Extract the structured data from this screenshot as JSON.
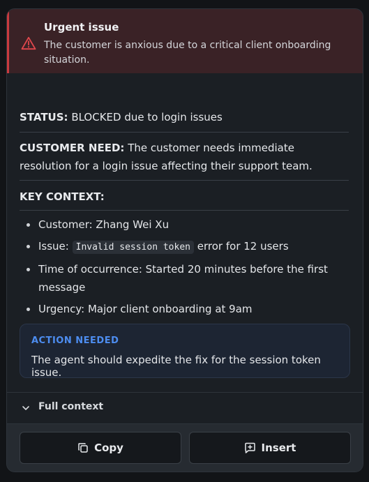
{
  "alert": {
    "title": "Urgent issue",
    "message": "The customer is anxious due to a critical client onboarding situation.",
    "icon": "warning-icon",
    "color": "#c93a3f"
  },
  "summary": {
    "status_label": "STATUS:",
    "status_text": "BLOCKED due to login issues",
    "need_label": "CUSTOMER NEED:",
    "need_text": "The customer needs immediate resolution for a login issue affecting their support team.",
    "context_label": "KEY CONTEXT:",
    "context_items": {
      "customer": "Customer: Zhang Wei Xu",
      "issue_prefix": "Issue:",
      "issue_code": "Invalid session token",
      "issue_suffix": "error for 12 users",
      "time": "Time of occurrence: Started 20 minutes before the first message",
      "urgency": "Urgency: Major client onboarding at 9am"
    }
  },
  "action": {
    "title": "ACTION NEEDED",
    "text": "The agent should expedite the fix for the session token issue.",
    "accent": "#4d8df0"
  },
  "full_context": {
    "label": "Full context",
    "icon": "chevron-down-icon"
  },
  "buttons": {
    "copy_label": "Copy",
    "copy_icon": "copy-icon",
    "insert_label": "Insert",
    "insert_icon": "insert-icon"
  }
}
